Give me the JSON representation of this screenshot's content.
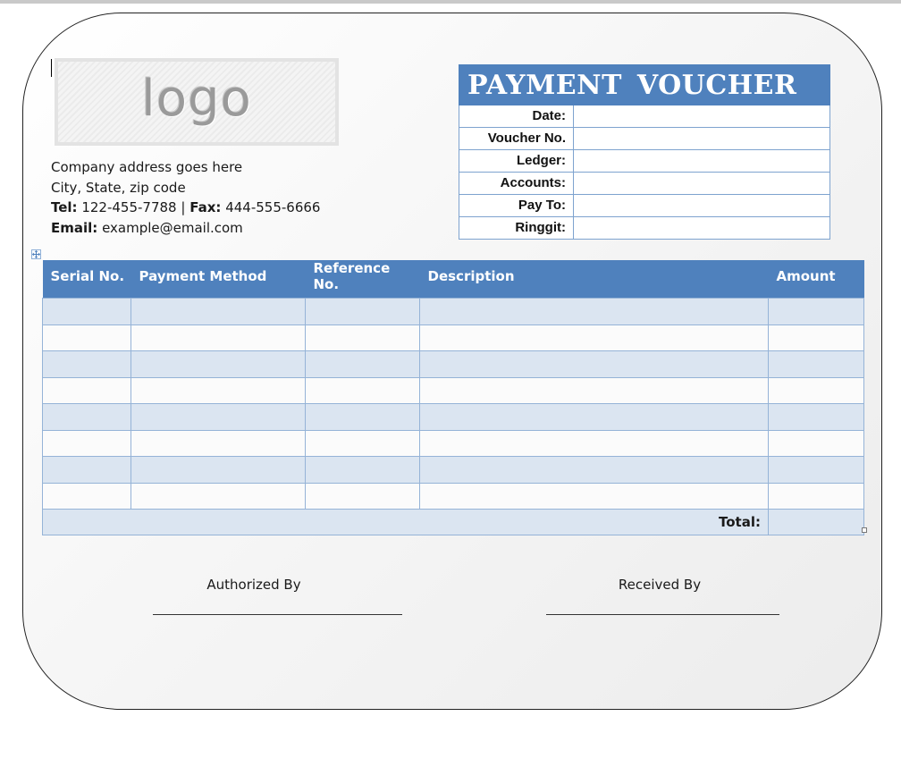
{
  "logo": {
    "text": "logo"
  },
  "company": {
    "address_line1": "Company address goes here",
    "address_line2": "City, State, zip code",
    "tel_label": "Tel:",
    "tel_value": "122-455-7788",
    "separator": "|",
    "fax_label": "Fax:",
    "fax_value": "444-555-6666",
    "email_label": "Email:",
    "email_value": "example@email.com"
  },
  "voucher": {
    "title": "PAYMENT  VOUCHER",
    "fields": [
      {
        "label": "Date:",
        "value": ""
      },
      {
        "label": "Voucher No.",
        "value": ""
      },
      {
        "label": "Ledger:",
        "value": ""
      },
      {
        "label": "Accounts:",
        "value": ""
      },
      {
        "label": "Pay To:",
        "value": ""
      },
      {
        "label": "Ringgit:",
        "value": ""
      }
    ]
  },
  "table": {
    "headers": [
      "Serial No.",
      "Payment Method",
      "Reference No.",
      "Description",
      "Amount"
    ],
    "rows": [
      [
        "",
        "",
        "",
        "",
        ""
      ],
      [
        "",
        "",
        "",
        "",
        ""
      ],
      [
        "",
        "",
        "",
        "",
        ""
      ],
      [
        "",
        "",
        "",
        "",
        ""
      ],
      [
        "",
        "",
        "",
        "",
        ""
      ],
      [
        "",
        "",
        "",
        "",
        ""
      ],
      [
        "",
        "",
        "",
        "",
        ""
      ],
      [
        "",
        "",
        "",
        "",
        ""
      ]
    ],
    "total_label": "Total:",
    "total_value": ""
  },
  "signatures": {
    "authorized": "Authorized  By",
    "received": "Received By"
  },
  "colors": {
    "header_blue": "#4f81bd",
    "band_light": "#dbe5f1",
    "border_blue": "#95b3d7"
  },
  "icons": {
    "table_move": "table-move-handle-icon",
    "table_resize": "table-resize-handle-icon"
  }
}
